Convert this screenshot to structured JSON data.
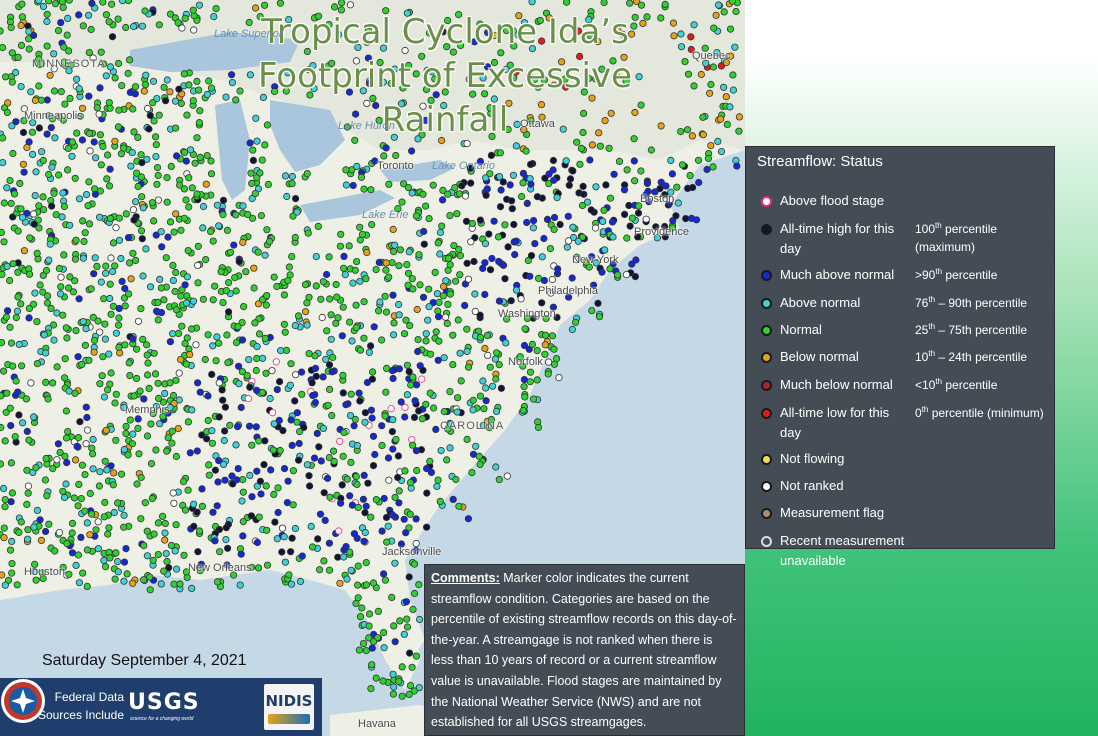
{
  "title": {
    "lines": [
      "Tropical Cyclone Ida’s",
      "Footprint of Excessive",
      "Rainfall"
    ]
  },
  "map": {
    "places": {
      "minnesota": "MINNESOTA",
      "lake_superior": "Lake Superior",
      "minneapolis": "Minneapolis",
      "lake_huron": "Lake Huron",
      "quebec": "Quebec",
      "ottawa": "Ottawa",
      "toronto": "Toronto",
      "lake_ontario": "Lake Ontario",
      "lake_erie": "Lake Erie",
      "boston": "Boston",
      "providence": "Providence",
      "new_york": "New York",
      "philadelphia": "Philadelphia",
      "washington": "Washington",
      "norfolk": "Norfolk",
      "carolina": "CAROLINA",
      "memphis": "Memphis",
      "jacksonville": "Jacksonville",
      "new_orleans": "New Orleans",
      "houston": "Houston",
      "havana": "Havana"
    }
  },
  "date_label": "Saturday September 4, 2021",
  "logos": {
    "sources_text": "Federal Data Sources Include",
    "usgs_wordmark": "USGS",
    "usgs_tagline": "science for a changing world",
    "nidis_wordmark": "NIDIS"
  },
  "comments": {
    "lead": "Comments:",
    "text": " Marker color indicates the current streamflow condition. Categories are based on the percentile of existing streamflow records on this day-of-the-year. A streamgage is not ranked when there is less than 10 years of record or a current streamflow value is unavailable. Flood stages are maintained by the National Weather Service (NWS) and are not established for all USGS streamgages."
  },
  "legend": {
    "title": "Streamflow: Status",
    "items": [
      {
        "label": "Above flood stage",
        "pct_main": "",
        "pct_sup": "",
        "pct_rest": "",
        "color": "#ffffff",
        "ring": "#e0307a"
      },
      {
        "label": "All-time high for this day",
        "pct_main": "100",
        "pct_sup": "th",
        "pct_rest": " percentile (maximum)",
        "color": "#101535",
        "ring": "#1a1a1a"
      },
      {
        "label": "Much above normal",
        "pct_main": ">90",
        "pct_sup": "th",
        "pct_rest": " percentile",
        "color": "#1428d6",
        "ring": "#1a1a1a"
      },
      {
        "label": "Above normal",
        "pct_main": "76",
        "pct_sup": "th",
        "pct_rest": " – 90th percentile",
        "color": "#3fd1d6",
        "ring": "#1a1a1a"
      },
      {
        "label": "Normal",
        "pct_main": "25",
        "pct_sup": "th",
        "pct_rest": " – 75th percentile",
        "color": "#2fd12f",
        "ring": "#1a1a1a"
      },
      {
        "label": "Below normal",
        "pct_main": "10",
        "pct_sup": "th",
        "pct_rest": " – 24th percentile",
        "color": "#e8a21a",
        "ring": "#1a1a1a"
      },
      {
        "label": "Much below normal",
        "pct_main": "<10",
        "pct_sup": "th",
        "pct_rest": " percentile",
        "color": "#a8242c",
        "ring": "#1a1a1a"
      },
      {
        "label": "All-time low for this day",
        "pct_main": "0",
        "pct_sup": "th",
        "pct_rest": " percentile (minimum)",
        "color": "#e41a1a",
        "ring": "#1a1a1a"
      },
      {
        "label": "Not flowing",
        "pct_main": "",
        "pct_sup": "",
        "pct_rest": "",
        "color": "#f4e24a",
        "ring": "#1a1a1a"
      },
      {
        "label": "Not ranked",
        "pct_main": "",
        "pct_sup": "",
        "pct_rest": "",
        "color": "#ffffff",
        "ring": "#1a1a1a"
      },
      {
        "label": "Measurement flag",
        "pct_main": "",
        "pct_sup": "",
        "pct_rest": "",
        "color": "#a89070",
        "ring": "#1a1a1a"
      },
      {
        "label": "Recent measurement unavailable",
        "pct_main": "",
        "pct_sup": "",
        "pct_rest": "",
        "color": "#444d56",
        "ring": "#dddddd"
      }
    ]
  }
}
